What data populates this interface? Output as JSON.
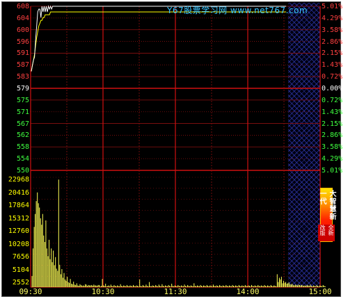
{
  "watermark": "Y67股票学习网 www.net767.com",
  "price_axis": {
    "labels": [
      "608",
      "604",
      "600",
      "596",
      "591",
      "587",
      "583",
      "579",
      "575",
      "571",
      "567",
      "562",
      "558",
      "554",
      "550"
    ],
    "colors": [
      "red",
      "red",
      "red",
      "red",
      "red",
      "red",
      "red",
      "white",
      "green",
      "green",
      "green",
      "green",
      "green",
      "green",
      "green"
    ]
  },
  "pct_axis": {
    "labels": [
      "5.01%",
      "4.29%",
      "3.58%",
      "2.86%",
      "2.15%",
      "1.43%",
      "0.72%",
      "0.00%",
      "0.72%",
      "1.43%",
      "2.15%",
      "2.86%",
      "3.58%",
      "4.29%",
      "5.01%"
    ],
    "colors": [
      "red",
      "red",
      "red",
      "red",
      "red",
      "red",
      "red",
      "white",
      "green",
      "green",
      "green",
      "green",
      "green",
      "green",
      "green"
    ]
  },
  "volume_axis": {
    "labels": [
      "22968",
      "20416",
      "17864",
      "15312",
      "12760",
      "10208",
      "7656",
      "5104",
      "2552"
    ]
  },
  "time_axis": {
    "labels": [
      "09:30",
      "10:30",
      "11:30",
      "14:00",
      "15:00"
    ]
  },
  "promo": {
    "title": "大智慧新一代",
    "subtitle": "全新改版"
  },
  "colors": {
    "grid_red": "#8b1010",
    "midline": "#d01010",
    "price_line": "#ffffff",
    "avg_line": "#ffff00",
    "volume_bar": "#ffff55",
    "watermark": "#39c6ff"
  },
  "chart_data": {
    "type": "line",
    "title": "",
    "series": [
      {
        "values": [
          585,
          587,
          589,
          590,
          596,
          601,
          606,
          607,
          607,
          604,
          608,
          606,
          608,
          606,
          608,
          606,
          608,
          607,
          608,
          607,
          608,
          608,
          608,
          608,
          608,
          608,
          608,
          608,
          608,
          608,
          608,
          608,
          608,
          608,
          608,
          608,
          608,
          608,
          608,
          608,
          608,
          608,
          608,
          608,
          608,
          608,
          608,
          608,
          608,
          608,
          608,
          608,
          608,
          608,
          608,
          608,
          608,
          608,
          608,
          608,
          608
        ]
      },
      {
        "values": [
          585,
          587,
          589,
          591,
          594,
          597,
          599,
          601,
          602,
          603,
          603,
          604,
          604,
          605,
          605,
          605,
          605,
          605,
          606,
          606,
          606,
          606,
          606,
          606,
          606,
          606,
          606,
          606,
          606,
          606,
          606,
          606,
          606,
          606,
          606,
          606,
          606,
          606,
          606,
          606,
          606,
          606,
          606,
          606,
          606,
          606,
          606,
          606,
          606,
          606,
          606,
          606,
          606,
          606,
          606,
          606,
          606,
          606,
          606,
          606,
          606
        ]
      }
    ],
    "price_range": [
      550,
      608
    ],
    "reference_price": 579,
    "volume_range": [
      0,
      25520
    ],
    "volume": [
      2600,
      9000,
      14000,
      17000,
      20000,
      22000,
      19500,
      18500,
      16000,
      14500,
      17000,
      12000,
      10500,
      15500,
      9000,
      7200,
      11000,
      6500,
      9000,
      5800,
      8500,
      5100,
      7000,
      4300,
      3800,
      25000,
      5200,
      3000,
      4200,
      2200,
      3300,
      1800,
      1500,
      2400,
      1200,
      1000,
      1900,
      800,
      700,
      1300,
      600,
      500,
      900,
      400,
      300,
      700,
      500,
      300,
      400,
      300,
      700,
      600,
      300,
      500,
      400,
      400,
      500,
      300,
      600,
      400,
      400,
      300,
      500,
      500,
      200,
      300,
      1900,
      400,
      300,
      800,
      200,
      300,
      400,
      200,
      600,
      300,
      200,
      500,
      300,
      200,
      400,
      300,
      200,
      700,
      300,
      200,
      400,
      300,
      200,
      500,
      300,
      200,
      400,
      300,
      200,
      500,
      300,
      200,
      400,
      300,
      200,
      1800,
      300,
      200,
      500,
      300,
      200,
      600,
      300,
      200,
      1200,
      300,
      200,
      400,
      300,
      200,
      500,
      300,
      200,
      600,
      300,
      200,
      700,
      300,
      200,
      400,
      300,
      200,
      500,
      300,
      200,
      800,
      300,
      200,
      400,
      300,
      200,
      500,
      300,
      200,
      400,
      300,
      200,
      600,
      300,
      200,
      500,
      300,
      200,
      400,
      300,
      200,
      900,
      300,
      200,
      400,
      300,
      200,
      500,
      300,
      200,
      400,
      300,
      200,
      500,
      300,
      200,
      400,
      300,
      200,
      600,
      300,
      200,
      400,
      300,
      200,
      500,
      300,
      200,
      400,
      300,
      200,
      500,
      300,
      200,
      400,
      300,
      200,
      500,
      300,
      200,
      400,
      300,
      200,
      500,
      300,
      200,
      400,
      300,
      200,
      500,
      300,
      200,
      400,
      300,
      200,
      500,
      300,
      200,
      400,
      300,
      200,
      500,
      300,
      200,
      400,
      300,
      200,
      500,
      300,
      200,
      400,
      300,
      200,
      500,
      300,
      200,
      400,
      300,
      200,
      3000,
      1200,
      2200,
      1800,
      2400,
      900,
      1500,
      1000,
      1200,
      800,
      900,
      1100,
      700,
      600,
      800,
      500,
      400,
      600,
      500,
      400,
      600,
      500,
      400,
      500,
      400,
      300,
      400,
      300,
      500,
      400,
      300,
      600,
      300,
      200,
      400,
      300,
      200,
      500,
      300,
      200,
      400,
      300,
      200,
      500,
      300,
      200
    ]
  }
}
